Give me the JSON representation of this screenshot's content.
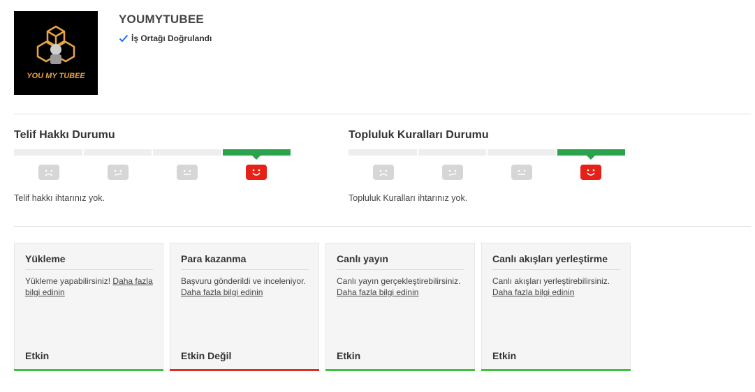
{
  "header": {
    "channel_name": "YOUMYTUBEE",
    "verified_label": "İş Ortağı Doğrulandı",
    "logo_text": "YOU MY TUBEE",
    "logo_icon": "cubes-logo"
  },
  "copyright_status": {
    "title": "Telif Hakkı Durumu",
    "message": "Telif hakkı ihtarınız yok.",
    "strike_count": 0,
    "active_level": 4,
    "faces": [
      "sad-face-icon",
      "neutral-face-icon",
      "neutral-face-icon",
      "happy-face-icon"
    ]
  },
  "community_status": {
    "title": "Topluluk Kuralları Durumu",
    "message": "Topluluk Kuralları ihtarınız yok.",
    "strike_count": 0,
    "active_level": 4,
    "faces": [
      "sad-face-icon",
      "neutral-face-icon",
      "neutral-face-icon",
      "happy-face-icon"
    ]
  },
  "features": [
    {
      "title": "Yükleme",
      "desc": "Yükleme yapabilirsiniz!",
      "link": "Daha fazla bilgi edinin",
      "status": "Etkin",
      "status_color": "#3ec23e"
    },
    {
      "title": "Para kazanma",
      "desc": "Başvuru gönderildi ve inceleniyor.",
      "link": "Daha fazla bilgi edinin",
      "status": "Etkin Değil",
      "status_color": "#d93025"
    },
    {
      "title": "Canlı yayın",
      "desc": "Canlı yayın gerçekleştirebilirsiniz.",
      "link": "Daha fazla bilgi edinin",
      "status": "Etkin",
      "status_color": "#3ec23e"
    },
    {
      "title": "Canlı akışları yerleştirme",
      "desc": "Canlı akışları yerleştirebilirsiniz.",
      "link": "Daha fazla bilgi edinin",
      "status": "Etkin",
      "status_color": "#3ec23e"
    }
  ],
  "colors": {
    "accent_green": "#2ba24c",
    "strike_red": "#e62117",
    "inactive_gray": "#d6d6d6",
    "verified_check": "#1a73e8"
  }
}
